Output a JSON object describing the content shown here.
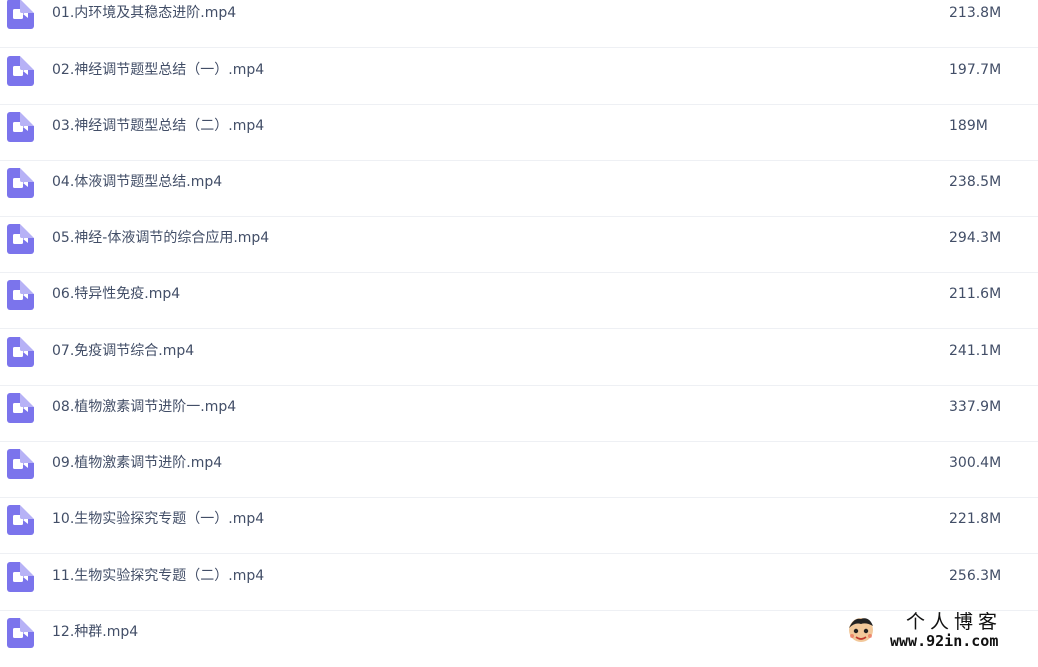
{
  "file_list": {
    "items": [
      {
        "name": "01.内环境及其稳态进阶.mp4",
        "size": "213.8M",
        "icon": "video-file-icon"
      },
      {
        "name": "02.神经调节题型总结（一）.mp4",
        "size": "197.7M",
        "icon": "video-file-icon"
      },
      {
        "name": "03.神经调节题型总结（二）.mp4",
        "size": "189M",
        "icon": "video-file-icon"
      },
      {
        "name": "04.体液调节题型总结.mp4",
        "size": "238.5M",
        "icon": "video-file-icon"
      },
      {
        "name": "05.神经-体液调节的综合应用.mp4",
        "size": "294.3M",
        "icon": "video-file-icon"
      },
      {
        "name": "06.特异性免疫.mp4",
        "size": "211.6M",
        "icon": "video-file-icon"
      },
      {
        "name": "07.免疫调节综合.mp4",
        "size": "241.1M",
        "icon": "video-file-icon"
      },
      {
        "name": "08.植物激素调节进阶一.mp4",
        "size": "337.9M",
        "icon": "video-file-icon"
      },
      {
        "name": "09.植物激素调节进阶.mp4",
        "size": "300.4M",
        "icon": "video-file-icon"
      },
      {
        "name": "10.生物实验探究专题（一）.mp4",
        "size": "221.8M",
        "icon": "video-file-icon"
      },
      {
        "name": "11.生物实验探究专题（二）.mp4",
        "size": "256.3M",
        "icon": "video-file-icon"
      },
      {
        "name": "12.种群.mp4",
        "size": "",
        "icon": "video-file-icon"
      }
    ]
  },
  "watermark": {
    "title": "个人博客",
    "url": "www.92in.com"
  },
  "colors": {
    "icon_fill": "#7b74ec",
    "text": "#424e67",
    "divider": "#eef0f4"
  }
}
